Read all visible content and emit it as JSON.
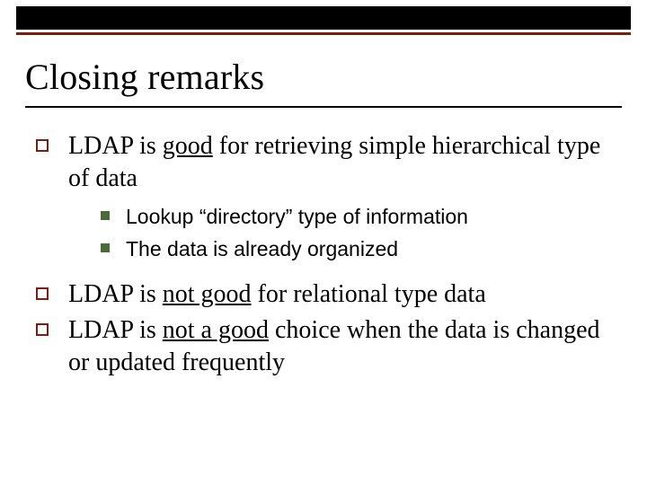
{
  "title": "Closing remarks",
  "points": [
    {
      "pre": "LDAP is ",
      "u": "good",
      "post": " for retrieving simple hierarchical type of data",
      "sub": [
        "Lookup “directory” type of information",
        "The data is already organized"
      ]
    },
    {
      "pre": "LDAP is ",
      "u": "not good",
      "post": " for relational type data",
      "sub": []
    },
    {
      "pre": "LDAP is ",
      "u": "not a good",
      "post": " choice when the data is changed or updated frequently",
      "sub": []
    }
  ]
}
